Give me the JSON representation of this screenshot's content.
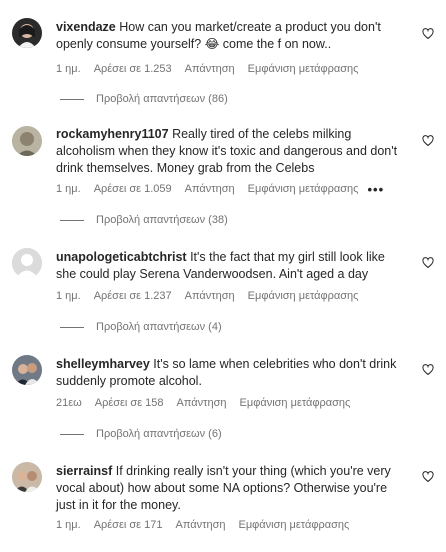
{
  "comments": [
    {
      "username": "vixendaze",
      "text": "How can you market/create a product you don't openly consume yourself? 😂 come the f on now..",
      "age": "1 ημ.",
      "likes": "Αρέσει σε 1.253",
      "reply": "Απάντηση",
      "translate": "Εμφάνιση μετάφρασης",
      "replies_label": "Προβολή απαντήσεων (86)",
      "avatar_color": "#2b2b2b"
    },
    {
      "username": "rockamyhenry1107",
      "text": "Really tired of the celebs milking alcoholism when they know it's toxic and dangerous and don't drink themselves. Money grab from the Celebs",
      "age": "1 ημ.",
      "likes": "Αρέσει σε 1.059",
      "reply": "Απάντηση",
      "translate": "Εμφάνιση μετάφρασης",
      "more": "•••",
      "replies_label": "Προβολή απαντήσεων (38)",
      "avatar_color": "#b9b3a2"
    },
    {
      "username": "unapologeticabtchrist",
      "text": "It's the fact that my girl still look like she could play Serena Vanderwoodsen. Ain't aged a day",
      "age": "1 ημ.",
      "likes": "Αρέσει σε 1.237",
      "reply": "Απάντηση",
      "translate": "Εμφάνιση μετάφρασης",
      "replies_label": "Προβολή απαντήσεων (4)",
      "avatar_color": "#dbdbdb"
    },
    {
      "username": "shelleymharvey",
      "text": "It's so lame when celebrities who don't drink suddenly promote alcohol.",
      "age": "21εω",
      "likes": "Αρέσει σε 158",
      "reply": "Απάντηση",
      "translate": "Εμφάνιση μετάφρασης",
      "replies_label": "Προβολή απαντήσεων (6)",
      "avatar_color": "#6f7a86"
    },
    {
      "username": "sierrainsf",
      "text": "If drinking really isn't your thing (which you're very vocal about) how about some NA options? Otherwise you're just in it for the money.",
      "age": "1 ημ.",
      "likes": "Αρέσει σε 171",
      "reply": "Απάντηση",
      "translate": "Εμφάνιση μετάφρασης",
      "avatar_color": "#c9b9a6"
    }
  ]
}
